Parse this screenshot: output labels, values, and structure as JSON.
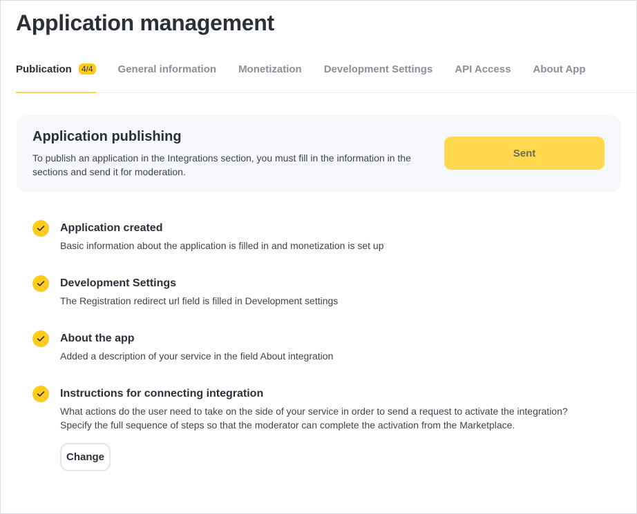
{
  "header": {
    "title": "Application management"
  },
  "tabs": [
    {
      "label": "Publication",
      "badge": "4/4",
      "active": true
    },
    {
      "label": "General information"
    },
    {
      "label": "Monetization"
    },
    {
      "label": "Development Settings"
    },
    {
      "label": "API Access"
    },
    {
      "label": "About App"
    }
  ],
  "publishing": {
    "title": "Application publishing",
    "description": "To publish an application in the Integrations section, you must fill in the information in the sections and send it for moderation.",
    "button_label": "Sent"
  },
  "steps": [
    {
      "title": "Application created",
      "description": "Basic information about the application is filled in and monetization is set up",
      "icon": "check-icon"
    },
    {
      "title": "Development Settings",
      "description": "The Registration redirect url field is filled in Development settings",
      "icon": "check-icon"
    },
    {
      "title": "About the app",
      "description": "Added a description of your service in the field About integration",
      "icon": "check-icon"
    },
    {
      "title": "Instructions for connecting integration",
      "description": "What actions do the user need to take on the side of your service in order to send a request to activate the integration? Specify the full sequence of steps so that the moderator can complete the activation from the Marketplace.",
      "icon": "check-icon",
      "button_label": "Change"
    }
  ],
  "colors": {
    "accent": "#ffcc1a",
    "button": "#ffd84d",
    "card_bg": "#f6f7fa"
  }
}
